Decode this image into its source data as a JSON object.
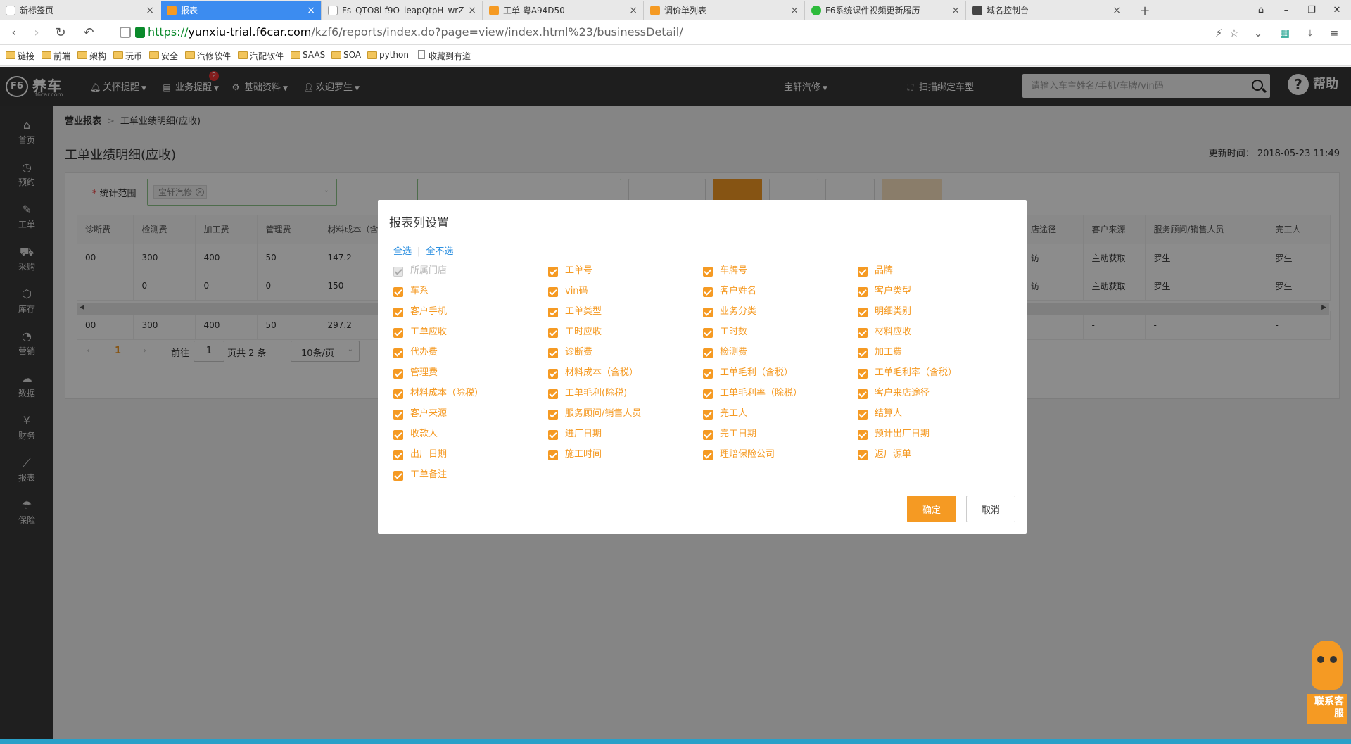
{
  "browser": {
    "tabs": [
      {
        "label": "新标签页",
        "icon": "grid-icon"
      },
      {
        "label": "报表",
        "icon": "f6-icon",
        "active": true
      },
      {
        "label": "Fs_QTO8l-f9O_ieapQtpH_wrZ",
        "icon": "doc-icon"
      },
      {
        "label": "工单 粤A94D50",
        "icon": "f6-icon"
      },
      {
        "label": "调价单列表",
        "icon": "f6-icon"
      },
      {
        "label": "F6系统课件视频更新履历",
        "icon": "wechat-icon"
      },
      {
        "label": "域名控制台",
        "icon": "dns-icon"
      }
    ],
    "url": {
      "scheme": "https://",
      "domain": "yunxiu-trial.f6car.com",
      "path": "/kzf6/reports/index.do?page=view/index.html%23/businessDetail/"
    },
    "bookmarks": [
      "链接",
      "前端",
      "架构",
      "玩币",
      "安全",
      "汽修软件",
      "汽配软件",
      "SAAS",
      "SOA",
      "python",
      "收藏到有道"
    ]
  },
  "header": {
    "logo_text": "养车",
    "logo_sub": "f6car.com",
    "menu": {
      "care": "关怀提醒",
      "business": "业务提醒",
      "basic": "基础资料",
      "welcome": "欢迎罗生"
    },
    "badge_count": "2",
    "shop": "宝轩汽修",
    "scan": "扫描绑定车型",
    "search_placeholder": "请输入车主姓名/手机/车牌/vin码",
    "help": "帮助"
  },
  "sidebar": [
    {
      "label": "首页",
      "icon": "home-icon"
    },
    {
      "label": "预约",
      "icon": "clock-icon"
    },
    {
      "label": "工单",
      "icon": "wrench-icon"
    },
    {
      "label": "采购",
      "icon": "cart-icon"
    },
    {
      "label": "库存",
      "icon": "box-icon"
    },
    {
      "label": "营销",
      "icon": "pie-icon"
    },
    {
      "label": "数据",
      "icon": "cloud-icon"
    },
    {
      "label": "财务",
      "icon": "yen-icon"
    },
    {
      "label": "报表",
      "icon": "chart-icon"
    },
    {
      "label": "保险",
      "icon": "umbrella-icon"
    }
  ],
  "page": {
    "breadcrumb_root": "营业报表",
    "breadcrumb_current": "工单业绩明细(应收)",
    "title": "工单业绩明细(应收)",
    "updated": "更新时间：  2018-05-23 11:49",
    "filter_label": "统计范围",
    "filter_chip": "宝轩汽修"
  },
  "table": {
    "left_headers": [
      "诊断费",
      "检测费",
      "加工费",
      "管理费",
      "材料成本（含税"
    ],
    "left_rows": [
      [
        "00",
        "300",
        "400",
        "50",
        "147.2"
      ],
      [
        "",
        "0",
        "0",
        "0",
        "150"
      ]
    ],
    "left_total": [
      "00",
      "300",
      "400",
      "50",
      "297.2"
    ],
    "right_headers": [
      "店途径",
      "客户来源",
      "服务顾问/销售人员",
      "完工人"
    ],
    "right_rows": [
      [
        "访",
        "主动获取",
        "罗生",
        "罗生"
      ],
      [
        "访",
        "主动获取",
        "罗生",
        "罗生"
      ]
    ],
    "right_total": [
      "",
      "-",
      "-",
      "-"
    ]
  },
  "pager": {
    "current": "1",
    "goto_label": "前往",
    "goto_value": "1",
    "total": "页共 2 条",
    "page_size": "10条/页"
  },
  "dialog": {
    "title": "报表列设置",
    "select_all": "全选",
    "select_none": "全不选",
    "options": [
      "所属门店",
      "工单号",
      "车牌号",
      "品牌",
      "车系",
      "vin码",
      "客户姓名",
      "客户类型",
      "客户手机",
      "工单类型",
      "业务分类",
      "明细类别",
      "工单应收",
      "工时应收",
      "工时数",
      "材料应收",
      "代办费",
      "诊断费",
      "检测费",
      "加工费",
      "管理费",
      "材料成本（含税）",
      "工单毛利（含税）",
      "工单毛利率（含税）",
      "材料成本（除税）",
      "工单毛利(除税)",
      "工单毛利率（除税）",
      "客户来店途径",
      "客户来源",
      "服务顾问/销售人员",
      "完工人",
      "结算人",
      "收款人",
      "进厂日期",
      "完工日期",
      "预计出厂日期",
      "出厂日期",
      "施工时间",
      "理赔保险公司",
      "返厂源单",
      "工单备注"
    ],
    "ok": "确定",
    "cancel": "取消"
  },
  "mascot_label": "联系客服",
  "colors": {
    "accent": "#f59a23",
    "link": "#2b8fe0",
    "header_bg": "#383838",
    "tab_active": "#3c8cf0"
  }
}
